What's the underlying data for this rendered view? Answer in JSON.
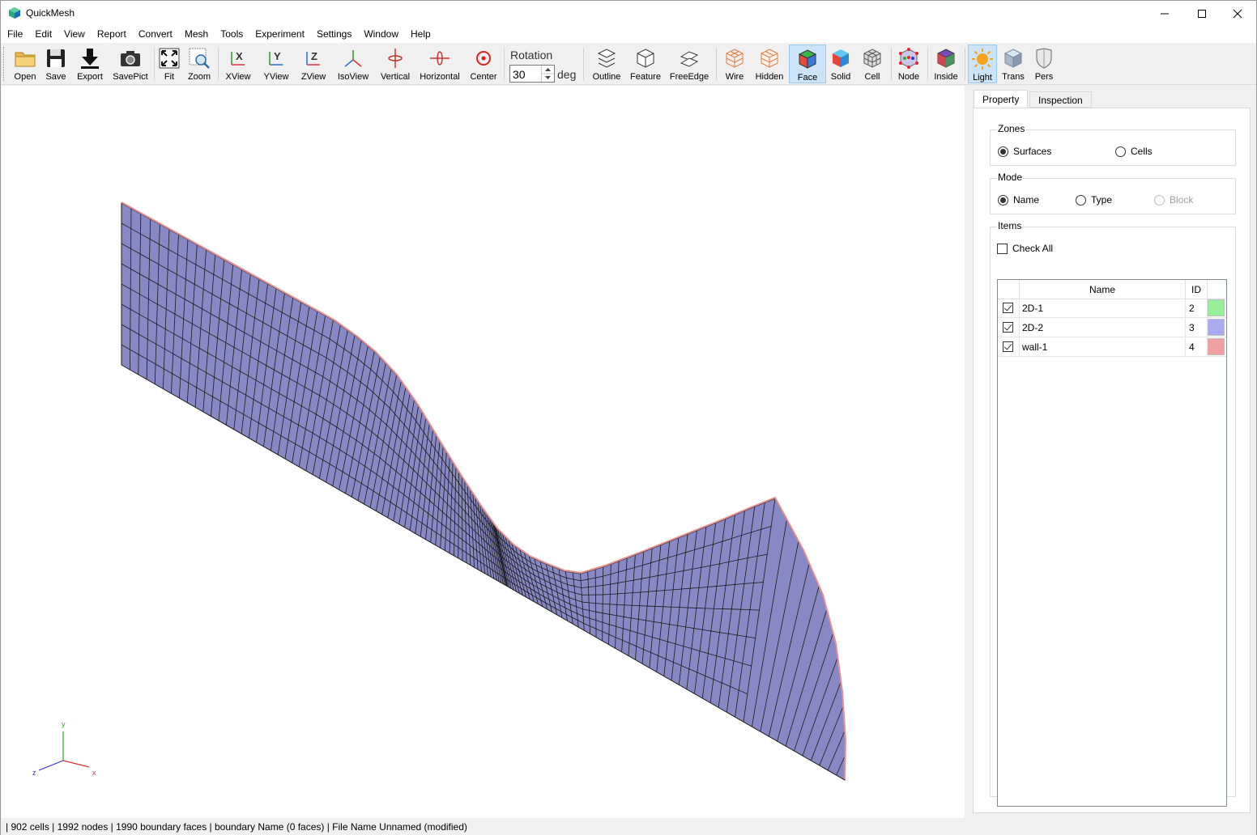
{
  "window": {
    "title": "QuickMesh",
    "controls": [
      "minimize",
      "maximize",
      "close"
    ]
  },
  "menu": [
    "File",
    "Edit",
    "View",
    "Report",
    "Convert",
    "Mesh",
    "Tools",
    "Experiment",
    "Settings",
    "Window",
    "Help"
  ],
  "toolbar": {
    "open": "Open",
    "save": "Save",
    "export": "Export",
    "savepict": "SavePict",
    "fit": "Fit",
    "zoom": "Zoom",
    "xview": "XView",
    "yview": "YView",
    "zview": "ZView",
    "isoview": "IsoView",
    "vertical": "Vertical",
    "horizontal": "Horizontal",
    "center": "Center",
    "rotation_label": "Rotation",
    "rotation_value": "30",
    "rotation_unit": "deg",
    "outline": "Outline",
    "feature": "Feature",
    "freeedge": "FreeEdge",
    "wire": "Wire",
    "hidden": "Hidden",
    "face": "Face",
    "solid": "Solid",
    "cell": "Cell",
    "node": "Node",
    "inside": "Inside",
    "light": "Light",
    "trans": "Trans",
    "pers": "Pers",
    "active": [
      "face",
      "light"
    ],
    "icon_letters": {
      "x": "X",
      "y": "Y",
      "z": "Z"
    }
  },
  "viewport": {
    "mesh_color": "#8888c4",
    "grid_color": "#1a1a1a",
    "wall_color": "#e89090",
    "axes": {
      "x": "x",
      "y": "y",
      "z": "z"
    }
  },
  "panel": {
    "tabs": [
      "Property",
      "Inspection"
    ],
    "active_tab": "Property",
    "zones": {
      "title": "Zones",
      "options": [
        "Surfaces",
        "Cells"
      ],
      "selected": "Surfaces"
    },
    "mode": {
      "title": "Mode",
      "options": [
        "Name",
        "Type",
        "Block"
      ],
      "selected": "Name",
      "disabled": [
        "Block"
      ]
    },
    "items": {
      "title": "Items",
      "check_all": "Check All",
      "check_all_checked": false,
      "columns": [
        "Name",
        "ID"
      ],
      "rows": [
        {
          "checked": true,
          "name": "2D-1",
          "id": "2",
          "color": "#99ee99"
        },
        {
          "checked": true,
          "name": "2D-2",
          "id": "3",
          "color": "#aaaaee"
        },
        {
          "checked": true,
          "name": "wall-1",
          "id": "4",
          "color": "#f0a0a0"
        }
      ]
    }
  },
  "status": " | 902 cells | 1992 nodes | 1990 boundary faces |  boundary Name  (0 faces) | File Name Unnamed (modified)"
}
